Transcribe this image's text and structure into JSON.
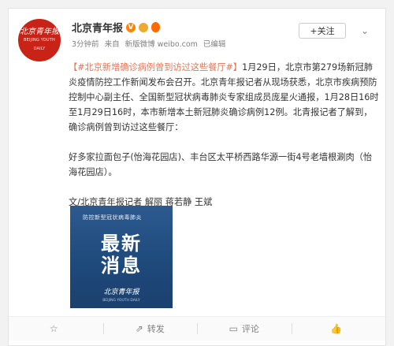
{
  "account": {
    "name": "北京青年报",
    "avatar_text": "北京青年报",
    "avatar_sub": "BEIJING YOUTH DAILY",
    "verified_mark": "V"
  },
  "meta": {
    "time": "3分钟前",
    "from": "来自",
    "source": "新版微博 weibo.com",
    "edited": "已编辑"
  },
  "follow": {
    "label": "+关注"
  },
  "post": {
    "hashtag": "【#北京新增确诊病例曾到访过这些餐厅#】",
    "body": "1月29日，北京市第279场新冠肺炎疫情防控工作新闻发布会召开。北京青年报记者从现场获悉，北京市疾病预防控制中心副主任、全国新型冠状病毒肺炎专家组成员庞星火通报，1月28日16时至1月29日16时，本市新增本土新冠肺炎确诊病例12例。北青报记者了解到，确诊病例曾到访过这些餐厅：",
    "restaurants": "好多家拉面包子(怡海花园店)、丰台区太平桥西路华源一街4号老墙根涮肉（怡海花园店）。",
    "byline": "文/北京青年报记者 解丽 蒋若静 王斌"
  },
  "image": {
    "caption": "防控新型冠状病毒肺炎",
    "title_line1": "最新",
    "title_line2": "消息",
    "logo": "北京青年报",
    "sub": "BEIJING YOUTH DAILY"
  },
  "actions": {
    "favorite_icon": "star-icon",
    "share_icon": "share-icon",
    "comment_icon": "comment-icon",
    "like_icon": "thumbs-up-icon",
    "favorite_label": "",
    "share_label": "转发",
    "comment_label": "评论",
    "like_label": ""
  },
  "colors": {
    "hashtag": "#eb7350",
    "avatar_bg": "#c92318",
    "image_bg": "#1e4a7c",
    "vip": "#ff8200"
  }
}
